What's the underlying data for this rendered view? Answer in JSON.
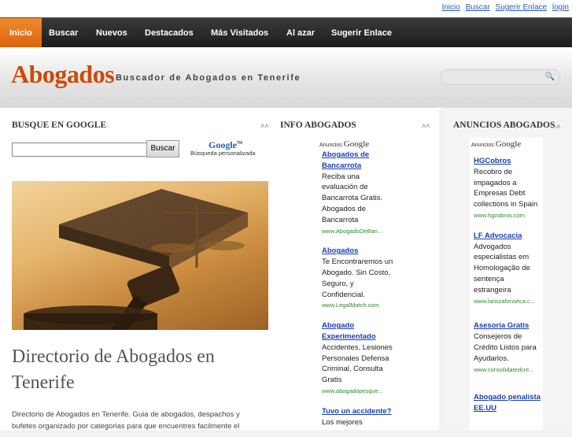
{
  "top_links": [
    "Inicio",
    "Buscar",
    "Sugerir Enlace",
    "login"
  ],
  "nav": [
    "Inicio",
    "Buscar",
    "Nuevos",
    "Destacados",
    "Más Visitados",
    "Al azar",
    "Sugerir Enlace"
  ],
  "header": {
    "logo": "Abogados",
    "tagline": "Buscador de Abogados en Tenerife",
    "search_value": ""
  },
  "google_box": {
    "title": "BUSQUE EN GOOGLE",
    "input_value": "",
    "button": "Buscar",
    "logo_text": "Google",
    "logo_tm": "TM",
    "subtitle": "Búsqueda personalizada"
  },
  "main": {
    "title": "Directorio de Abogados en Tenerife",
    "desc": "Directorio de Abogados en Tenerife. Guia de abogados, despachos y bufetes organizado por categorias para que encuentres facilmente el"
  },
  "info_box": {
    "title": "INFO ABOGADOS",
    "ads_label": "Anuncios",
    "ads_brand": "Google",
    "ads": [
      {
        "headline": "Abogados de Bancarrota",
        "body": "Reciba una evaluación de Bancarrota Gratis. Abogados de Bancarrota",
        "url": "www.AbogadoDeBan..."
      },
      {
        "headline": "Abogados",
        "body": "Te Encontraremos un Abogado. Sin Costo, Seguro, y Confidencial.",
        "url": "www.LegalMatch.com"
      },
      {
        "headline": "Abogado Experimentado",
        "body": "Accidentes, Lesiones Personales Defensa Criminal, Consulta Gratis",
        "url": "www.abogadopesque..."
      },
      {
        "headline": "Tuvo un accidente?",
        "body": "Los mejores",
        "url": ""
      }
    ]
  },
  "anuncios_box": {
    "title": "ANUNCIOS ABOGADOS",
    "ads_label": "Anuncios",
    "ads_brand": "Google",
    "ads": [
      {
        "headline": "HGCobros",
        "body": "Recobro de impagados a Empresas Debt collections in Spain",
        "url": "www.hgcobros.com"
      },
      {
        "headline": "LF Advocacia",
        "body": "Advogados especialistas em Homologação de sentença estrangeira",
        "url": "www.larissafonseca.c..."
      },
      {
        "headline": "Asesoría Gratis",
        "body": "Consejeros de Crédito Listos para Ayudarlos.",
        "url": "www.consolidatedcre..."
      },
      {
        "headline": "Abogado penalista EE.UU",
        "body": "",
        "url": ""
      }
    ]
  }
}
